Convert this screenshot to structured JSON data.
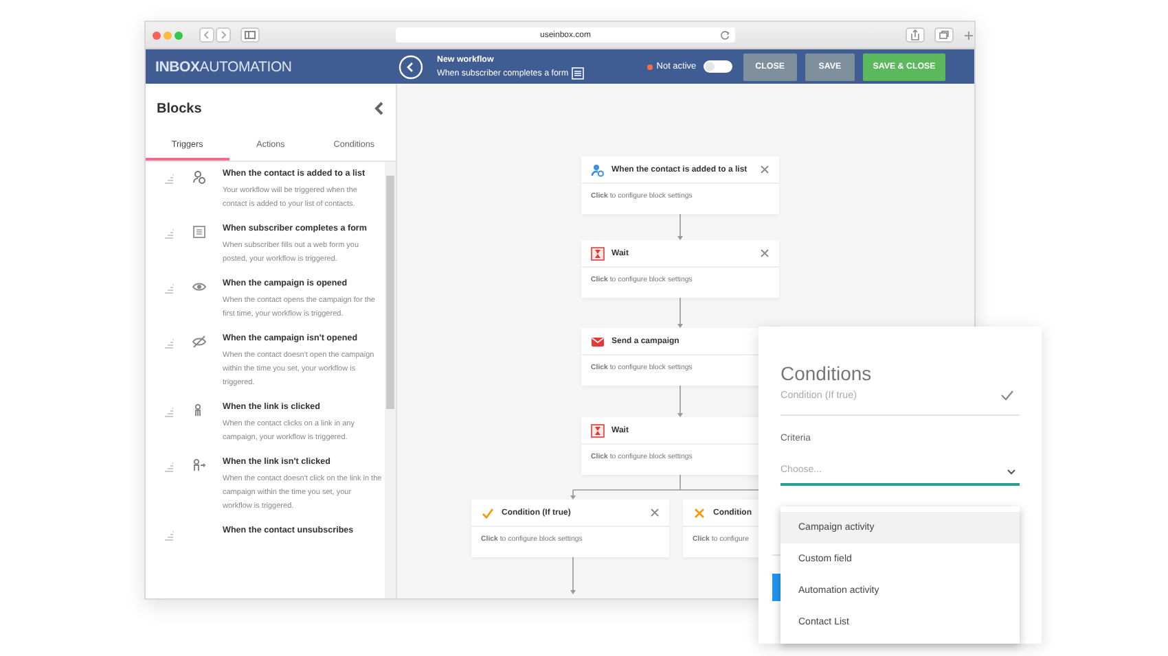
{
  "browser": {
    "url": "useinbox.com"
  },
  "app_header": {
    "logo": "**INBOX**AUTOMATION",
    "workflow_title": "New workflow",
    "workflow_trigger": "When subscriber completes a form",
    "status": {
      "label": "Not active",
      "active": false
    },
    "buttons": [
      {
        "label": "CLOSE",
        "kind": "secondary"
      },
      {
        "label": "SAVE",
        "kind": "secondary"
      },
      {
        "label": "SAVE & CLOSE",
        "kind": "primary"
      }
    ]
  },
  "sidebar": {
    "title": "Blocks",
    "tabs": [
      {
        "label": "Triggers",
        "selected": true
      },
      {
        "label": "Actions",
        "selected": false
      },
      {
        "label": "Conditions",
        "selected": false
      }
    ],
    "items": [
      {
        "kind": "list",
        "title": "When the contact is added to a list",
        "description": "Your workflow will be triggered when the contact is added to your list of contacts."
      },
      {
        "kind": "form",
        "title": "When subscriber completes a form",
        "description": "When subscriber fills out a web form you posted, your workflow is triggered."
      },
      {
        "kind": "open",
        "title": "When the campaign is opened",
        "description": "When the contact opens the campaign for the first time, your workflow is triggered."
      },
      {
        "kind": "not-open",
        "title": "When the campaign isn't opened",
        "description": "When the contact doesn't open the campaign within the time you set, your workflow is triggered."
      },
      {
        "kind": "click",
        "title": "When the link is clicked",
        "description": "When the contact clicks on a link in any campaign, your workflow is triggered."
      },
      {
        "kind": "no-click",
        "title": "When the link isn't clicked",
        "description": "When the contact doesn't click on the link in the campaign within the time you set, your workflow is triggered."
      },
      {
        "kind": "unsubscribe",
        "title": "When the contact unsubscribes"
      }
    ]
  },
  "canvas": {
    "nodes": [
      {
        "kind": "trigger",
        "title": "When the contact is added to a list",
        "body": "**Click** to configure block settings",
        "closable": true
      },
      {
        "kind": "wait",
        "title": "Wait",
        "body": "**Click** to configure block settings",
        "closable": true
      },
      {
        "kind": "campaign",
        "title": "Send a campaign",
        "body": "**Click** to configure block settings",
        "closable": false
      },
      {
        "kind": "wait",
        "title": "Wait",
        "body": "**Click** to configure block settings",
        "closable": false
      },
      {
        "kind": "condition-true",
        "title": "Condition (If true)",
        "body": "**Click** to configure block settings",
        "closable": true
      },
      {
        "kind": "condition-false",
        "title": "Condition",
        "body": "**Click** to configure",
        "closable": false
      }
    ]
  },
  "conditions_panel": {
    "title": "Conditions",
    "subtitle": "Condition (If true)",
    "criteria_label": "Criteria",
    "select": {
      "placeholder": "Choose..."
    },
    "options": [
      {
        "label": "Campaign activity",
        "selected": true
      },
      {
        "label": "Custom field",
        "selected": false
      },
      {
        "label": "Automation activity",
        "selected": false
      },
      {
        "label": "Contact List",
        "selected": false
      }
    ]
  }
}
